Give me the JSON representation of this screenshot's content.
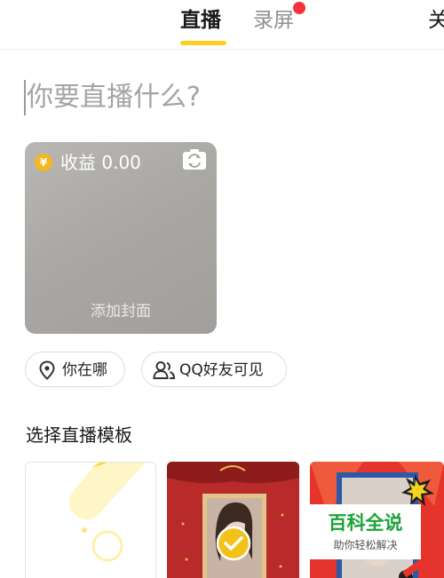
{
  "tabs": {
    "live": "直播",
    "record": "录屏",
    "close": "关"
  },
  "title_input": {
    "placeholder": "你要直播什么?"
  },
  "cover": {
    "earnings": "收益 0.00",
    "coin_symbol": "¥",
    "add_cover": "添加封面"
  },
  "chips": {
    "location": "你在哪",
    "privacy": "QQ好友可见"
  },
  "templates": {
    "section_title": "选择直播模板"
  },
  "watermark": {
    "main": "百科全说",
    "sub": "助你轻松解决"
  },
  "colors": {
    "accent": "#ffce1f",
    "notification": "#f4343a",
    "watermark_green": "#1da338"
  }
}
